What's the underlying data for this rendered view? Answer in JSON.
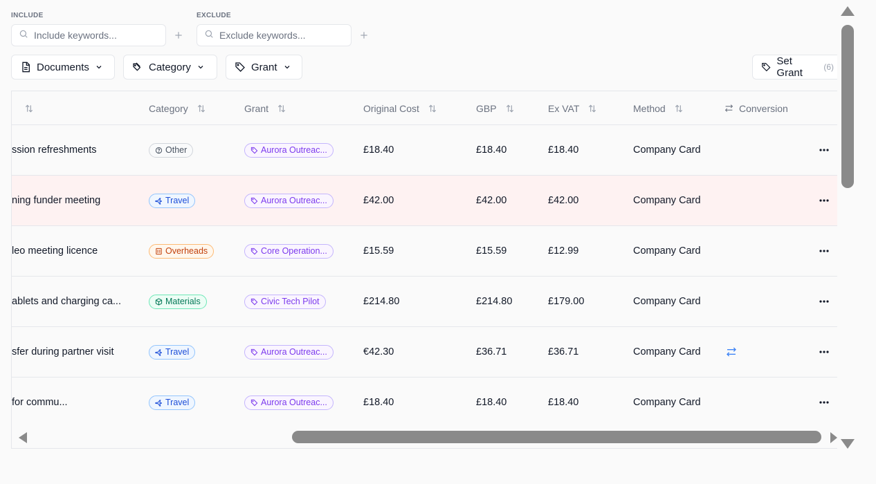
{
  "filters": {
    "include_label": "INCLUDE",
    "include_placeholder": "Include keywords...",
    "include_value": "",
    "exclude_label": "EXCLUDE",
    "exclude_placeholder": "Exclude keywords...",
    "exclude_value": ""
  },
  "toolbar": {
    "documents_label": "Documents",
    "category_label": "Category",
    "grant_label": "Grant",
    "set_grant_label": "Set Grant",
    "set_grant_count": "(6)"
  },
  "columns": {
    "category": "Category",
    "grant": "Grant",
    "original_cost": "Original Cost",
    "gbp": "GBP",
    "ex_vat": "Ex VAT",
    "method": "Method",
    "conversion": "Conversion"
  },
  "rows": [
    {
      "description": "ssion refreshments",
      "category": "Other",
      "category_icon": "question-circle-icon",
      "grant": "Aurora Outreac...",
      "original_cost": "£18.40",
      "gbp": "£18.40",
      "ex_vat": "£18.40",
      "method": "Company Card",
      "conversion": false,
      "highlight": false
    },
    {
      "description": "ning funder meeting",
      "category": "Travel",
      "category_icon": "plane-icon",
      "grant": "Aurora Outreac...",
      "original_cost": "£42.00",
      "gbp": "£42.00",
      "ex_vat": "£42.00",
      "method": "Company Card",
      "conversion": false,
      "highlight": true
    },
    {
      "description": "leo meeting licence",
      "category": "Overheads",
      "category_icon": "building-icon",
      "grant": "Core Operation...",
      "original_cost": "£15.59",
      "gbp": "£15.59",
      "ex_vat": "£12.99",
      "method": "Company Card",
      "conversion": false,
      "highlight": false
    },
    {
      "description": "ablets and charging ca...",
      "category": "Materials",
      "category_icon": "box-icon",
      "grant": "Civic Tech Pilot",
      "original_cost": "£214.80",
      "gbp": "£214.80",
      "ex_vat": "£179.00",
      "method": "Company Card",
      "conversion": false,
      "highlight": false
    },
    {
      "description": "sfer during partner visit",
      "category": "Travel",
      "category_icon": "plane-icon",
      "grant": "Aurora Outreac...",
      "original_cost": "€42.30",
      "gbp": "£36.71",
      "ex_vat": "£36.71",
      "method": "Company Card",
      "conversion": true,
      "highlight": false
    },
    {
      "description": " for commu...",
      "category": "Travel",
      "category_icon": "plane-icon",
      "grant": "Aurora Outreac...",
      "original_cost": "£18.40",
      "gbp": "£18.40",
      "ex_vat": "£18.40",
      "method": "Company Card",
      "conversion": false,
      "highlight": false
    }
  ],
  "colors": {
    "highlight_row": "#fef2f2",
    "grant_badge": "#7c3aed",
    "travel_badge": "#1d4ed8",
    "overheads_badge": "#c2410c",
    "materials_badge": "#047857",
    "conversion_icon": "#3b82f6"
  }
}
